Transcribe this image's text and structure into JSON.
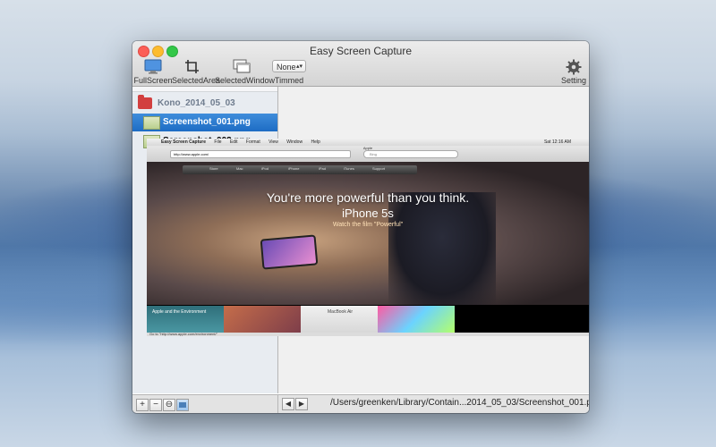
{
  "window": {
    "title": "Easy Screen Capture"
  },
  "toolbar": {
    "fullscreen_label": "FullScreen",
    "selectedarea_label": "SelectedArea",
    "selectedwindow_label": "SelectedWindow",
    "timed_label": "Timmed",
    "timed_value": "None",
    "setting_label": "Setting"
  },
  "sidebar": {
    "group_label": "Kono_2014_05_03",
    "files": [
      {
        "name": "Screenshot_001.png",
        "selected": true
      },
      {
        "name": "Screenshot_002.png",
        "selected": false
      }
    ],
    "footer_buttons": [
      "+",
      "−",
      "⊖"
    ]
  },
  "content": {
    "path": "/Users/greenken/Library/Contain...2014_05_03/Screenshot_001.png"
  },
  "preview": {
    "menubar_app": "Easy Screen Capture",
    "menubar_items": [
      "File",
      "Edit",
      "Format",
      "View",
      "Window",
      "Help"
    ],
    "menubar_clock": "Sat 12:16 AM",
    "page_title": "Apple",
    "url": "http://www.apple.com/",
    "search_placeholder": "Bing",
    "nav_items": [
      "Store",
      "Mac",
      "iPod",
      "iPhone",
      "iPad",
      "iTunes",
      "Support"
    ],
    "headline": "You're more powerful than you think.",
    "product": "iPhone 5s",
    "cta": "Watch the film \"Powerful\"",
    "tiles": [
      "Apple and the Environment",
      "",
      "MacBook Air",
      ""
    ],
    "status_text": "Go to \"http://www.apple.com/environment/\""
  }
}
